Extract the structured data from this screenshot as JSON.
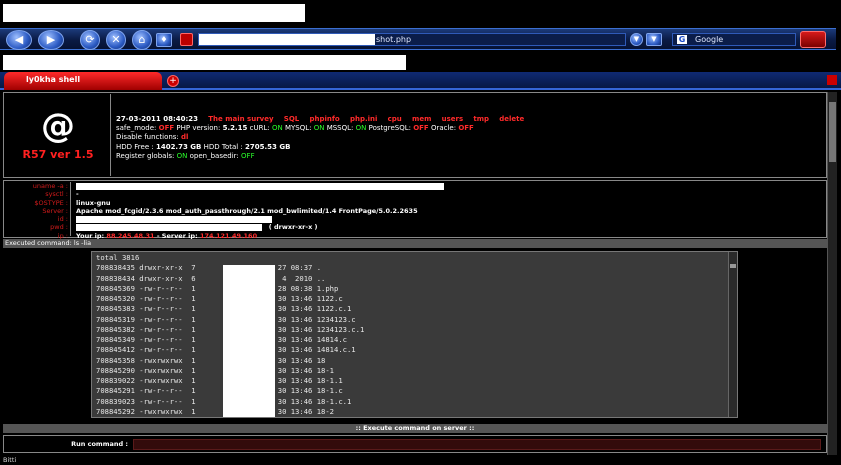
{
  "browser": {
    "address_suffix": "shot.php",
    "search_engine": "Google",
    "tab_title": "ly0kha shell",
    "status_text": "Bitti"
  },
  "logo": {
    "symbol": "@",
    "version": "R57 ver 1.5"
  },
  "header": {
    "datetime": "27-03-2011 08:40:23",
    "nav_links": [
      "The main survey",
      "SQL",
      "phpinfo",
      "php.ini",
      "cpu",
      "mem",
      "users",
      "tmp",
      "delete"
    ],
    "line1": {
      "safe_mode_label": "safe_mode:",
      "safe_mode_val": "OFF",
      "php_label": "PHP version:",
      "php_val": "5.2.15",
      "curl_label": "cURL:",
      "curl_val": "ON",
      "mysql_label": "MYSQL:",
      "mysql_val": "ON",
      "mssql_label": "MSSQL:",
      "mssql_val": "ON",
      "pg_label": "PostgreSQL:",
      "pg_val": "OFF",
      "oracle_label": "Oracle:",
      "oracle_val": "OFF"
    },
    "disable_functions_label": "Disable functions:",
    "disable_functions_val": "dl",
    "hdd_free_label": "HDD Free :",
    "hdd_free_val": "1402.73 GB",
    "hdd_total_label": "HDD Total :",
    "hdd_total_val": "2705.53 GB",
    "register_globals_label": "Register globals:",
    "register_globals_val": "ON",
    "open_basedir_label": "open_basedir:",
    "open_basedir_val": "OFF"
  },
  "sysinfo": {
    "labels": [
      "uname -a :",
      "sysctl :",
      "$OSTYPE :",
      "Server :",
      "id :",
      "pwd :",
      "ip :"
    ],
    "sysctl_val": "-",
    "ostype_val": "linux-gnu",
    "server_val": "Apache mod_fcgid/2.3.6 mod_auth_passthrough/2.1 mod_bwlimited/1.4 FrontPage/5.0.2.2635",
    "pwd_suffix": "( drwxr-xr-x )",
    "your_ip_label": "Your ip:",
    "your_ip_val": "88.245.48.31",
    "server_ip_label": "- Server ip:",
    "server_ip_val": "174.121.49.160"
  },
  "executed_command_label": "Executed command: ls -lia",
  "output_lines": [
    "total 3816",
    "708838435 drwxr-xr-x  7          4096 Mar 27 08:37 .",
    "708838434 drwxr-xr-x  6          4096 Sep  4  2010 ..",
    "708845369 -rw-r--r--  1         35514 Oct 28 08:38 1.php",
    "708845320 -rw-r--r--  1         44438 Sep 30 13:46 1122.c",
    "708845383 -rw-r--r--  1         44438 Sep 30 13:46 1122.c.1",
    "708845319 -rw-r--r--  1         44980 Sep 30 13:46 1234123.c",
    "708845382 -rw-r--r--  1         44980 Sep 30 13:46 1234123.c.1",
    "708845349 -rw-r--r--  1         14995 Sep 30 13:46 14814.c",
    "708845412 -rw-r--r--  1         14995 Sep 30 13:46 14814.c.1",
    "708845358 -rwxrwxrwx  1          8545 Sep 30 13:46 18",
    "708845290 -rwxrwxrwx  1          6698 Sep 30 13:46 18-1",
    "708839022 -rwxrwxrwx  1          6698 Sep 30 13:46 18-1.1",
    "708845291 -rw-r--r--  1          9409 Sep 30 13:46 18-1.c",
    "708839023 -rw-r--r--  1          9409 Sep 30 13:46 18-1.c.1",
    "708845292 -rwxrwxrwx  1          6698 Sep 30 13:46 18-2"
  ],
  "execute_bar": ":: Execute command on server ::",
  "run_command_label": "Run command :",
  "colors": {
    "accent_red": "#ff2a2a",
    "on_green": "#2aff2a",
    "toolbar_blue": "#1c3a7a"
  },
  "icons": [
    "back-arrow-icon",
    "forward-arrow-icon",
    "reload-icon",
    "stop-icon",
    "home-icon",
    "shield-icon",
    "search-go-icon"
  ]
}
